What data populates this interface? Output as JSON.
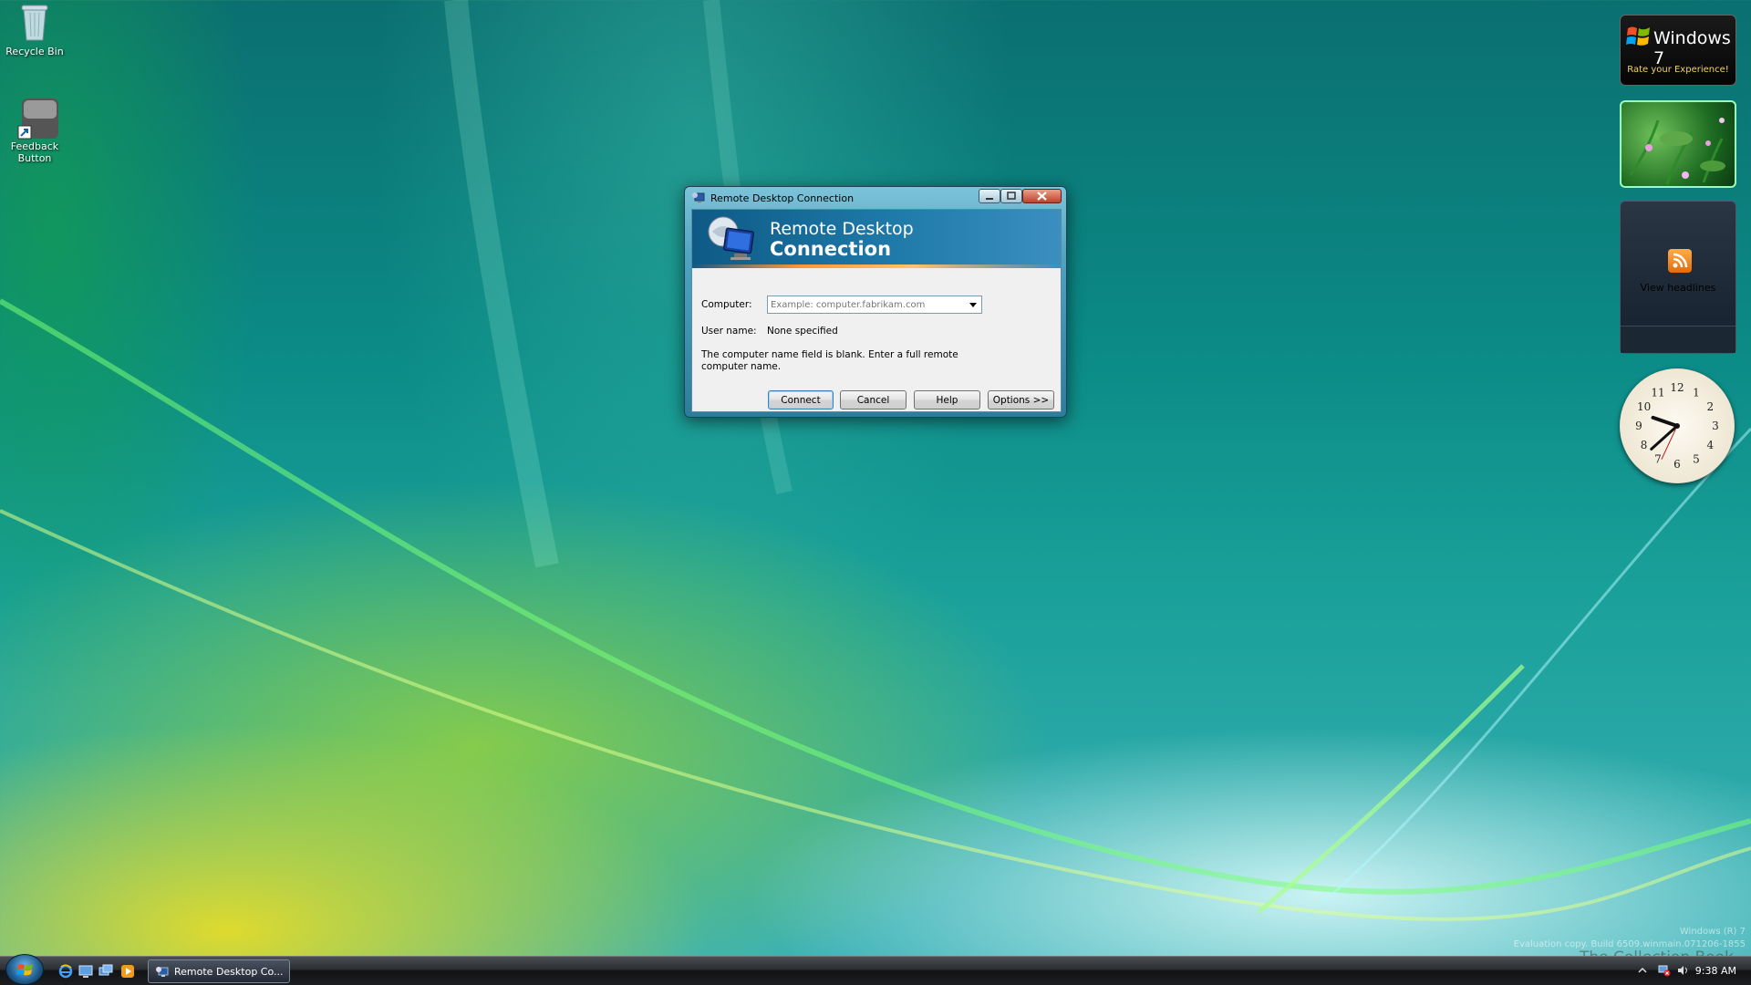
{
  "desktop": {
    "icons": [
      {
        "label": "Recycle Bin"
      },
      {
        "label": "Feedback Button"
      }
    ],
    "watermark_line1": "Windows (R) 7",
    "watermark_line2": "Evaluation copy. Build 6509.winmain.071206-1855",
    "watermark_book": "The Collection Book"
  },
  "gadgets": {
    "win7_title": "Windows 7",
    "win7_subtitle": "Rate your Experience!",
    "feed_label": "View headlines",
    "clock_numbers": [
      "12",
      "1",
      "2",
      "3",
      "4",
      "5",
      "6",
      "7",
      "8",
      "9",
      "10",
      "11"
    ]
  },
  "dialog": {
    "title": "Remote Desktop Connection",
    "banner_line1": "Remote Desktop",
    "banner_line2": "Connection",
    "computer_label": "Computer:",
    "computer_value": "",
    "computer_placeholder": "Example: computer.fabrikam.com",
    "username_label": "User name:",
    "username_value": "None specified",
    "message": "The computer name field is blank.  Enter a full remote computer name.",
    "buttons": {
      "connect": "Connect",
      "cancel": "Cancel",
      "help": "Help",
      "options": "Options >>"
    }
  },
  "taskbar": {
    "task_label": "Remote Desktop Co...",
    "clock": "9:38 AM",
    "quicklaunch": [
      "ie-icon",
      "show-desktop-icon",
      "switch-windows-icon",
      "media-player-icon"
    ]
  },
  "colors": {
    "accent": "#1f7aa9",
    "banner_stripe": "#ff9a2a",
    "rss": "#e36a0a"
  }
}
